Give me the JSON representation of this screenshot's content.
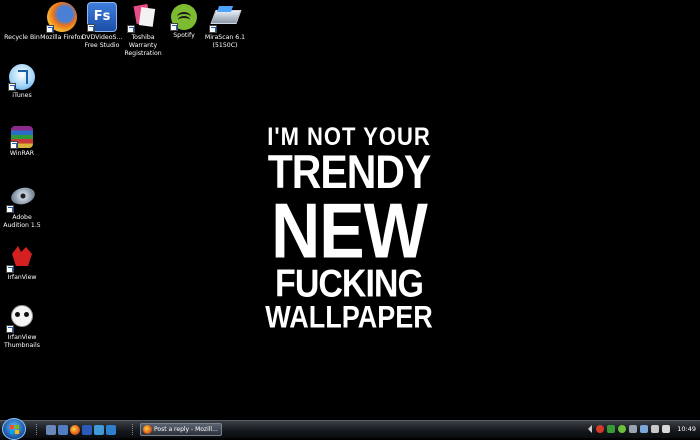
{
  "wallpaper": {
    "lines": [
      "I'M NOT YOUR",
      "TRENDY",
      "NEW",
      "FUCKING",
      "WALLPAPER"
    ]
  },
  "desktop_icons": [
    {
      "name": "recycle-bin",
      "label": "Recycle Bin"
    },
    {
      "name": "mozilla-firefox",
      "label": "Mozilla Firefox"
    },
    {
      "name": "dvdvideosoft",
      "label": "DVDVideoS... Free Studio"
    },
    {
      "name": "toshiba-warranty",
      "label": "Toshiba Warranty Registration"
    },
    {
      "name": "spotify",
      "label": "Spotify"
    },
    {
      "name": "mirascan",
      "label": "MiraScan 6.1 (5150C)"
    },
    {
      "name": "itunes",
      "label": "iTunes"
    },
    {
      "name": "winrar",
      "label": "WinRAR"
    },
    {
      "name": "adobe-audition",
      "label": "Adobe Audition 1.5"
    },
    {
      "name": "irfanview",
      "label": "IrfanView"
    },
    {
      "name": "irfanview-thumbnails",
      "label": "IrfanView Thumbnails"
    }
  ],
  "taskbar": {
    "task_button_label": "Post a reply - Mozill...",
    "clock": "10:49"
  },
  "icon_glyphs": {
    "dvd": "Fs"
  }
}
